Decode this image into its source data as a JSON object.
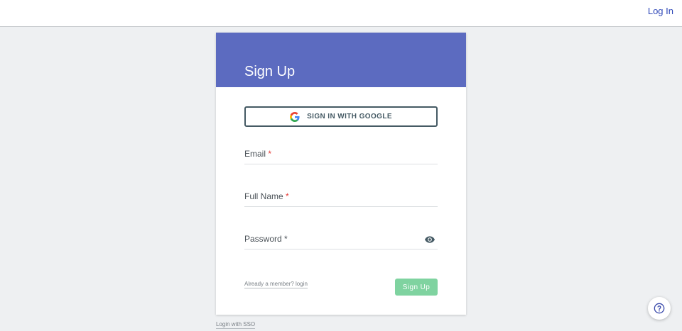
{
  "header": {
    "login_link": "Log In"
  },
  "card": {
    "title": "Sign Up",
    "google_button": {
      "label": "SIGN IN WITH GOOGLE",
      "icon": "google-icon"
    },
    "fields": {
      "email": {
        "label": "Email",
        "required_mark": "*"
      },
      "full_name": {
        "label": "Full Name",
        "required_mark": "*"
      },
      "password": {
        "label": "Password",
        "required_mark": "*",
        "toggle_icon": "eye-icon"
      }
    },
    "already_member_link": "Already a member? login",
    "submit_label": "Sign Up"
  },
  "footer": {
    "sso_link": "Login with SSO"
  },
  "help_button": {
    "icon": "help-circle-icon"
  },
  "colors": {
    "header_bg": "#5c6bc0",
    "accent_link": "#2f48b8",
    "submit_bg": "#7fd3a0",
    "required": "#e53935",
    "page_bg": "#eef0f2"
  }
}
